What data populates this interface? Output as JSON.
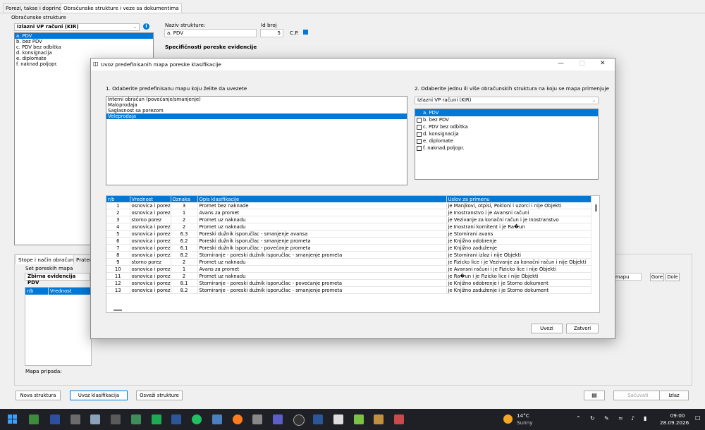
{
  "tabs": [
    {
      "label": "Porezi, takse i doprinosi"
    },
    {
      "label": "Obračunske strukture i veze sa dokumentima"
    }
  ],
  "left": {
    "title": "Obračunske strukture",
    "combo_value": "Izlazni VP računi (KIR)",
    "items": [
      {
        "label": "a. PDV"
      },
      {
        "label": "b. bez PDV"
      },
      {
        "label": "c. PDV bez odbitka"
      },
      {
        "label": "d. konsignacija"
      },
      {
        "label": "e. diplomate"
      },
      {
        "label": "f. naknad.poljopr."
      }
    ]
  },
  "form": {
    "naziv_label": "Naziv strukture:",
    "naziv_value": "a. PDV",
    "id_label": "Id broj",
    "id_value": "5",
    "cp_label": "C.P.",
    "section_title": "Specifičnosti poreske evidencije"
  },
  "lower": {
    "tab1": "Stope i način obračuna",
    "tab2": "Prateć",
    "set_label": "Set poreskih mapa",
    "set_combo": "Zbirna evidencija PDV",
    "col1": "r/b",
    "col2": "Vrednost",
    "mapu_label": "mapu",
    "gore": "Gore",
    "dole": "Dole",
    "mapa_pripada": "Mapa pripada:"
  },
  "dialog": {
    "title": "Uvoz predefinisanih mapa poreske klasifikacije",
    "step1": "1. Odaberite predefinisanu mapu koju želite da uvezete",
    "maps": [
      {
        "label": "Interni obračun (povećanje/smanjenje)"
      },
      {
        "label": "Maloprodaja"
      },
      {
        "label": "Saglasnost sa porezom"
      },
      {
        "label": "Veleprodaja"
      }
    ],
    "step2": "2. Odaberite jednu ili više obračunskih struktura na koju se mapa primenjuje",
    "struct_combo": "Izlazni VP računi (KIR)",
    "structures": [
      {
        "label": "a. PDV",
        "checked": true
      },
      {
        "label": "b. bez PDV",
        "checked": false
      },
      {
        "label": "c. PDV bez odbitka",
        "checked": false
      },
      {
        "label": "d. konsignacija",
        "checked": false
      },
      {
        "label": "e. diplomate",
        "checked": false
      },
      {
        "label": "f. naknad.poljopr.",
        "checked": false
      }
    ],
    "columns": [
      "r/b",
      "Vrednost",
      "Oznaka",
      "Opis klasifikacije",
      "Uslov za primenu"
    ],
    "rows": [
      [
        "1",
        "osnovica i porez",
        "3",
        "Promet bez naknade",
        "je Manjkovi, otpisi, Pokloni i uzorci i  nije Objekti"
      ],
      [
        "2",
        "osnovica i porez",
        "1",
        "Avans za promet",
        "je Inostranstvo i  je Avansni računi"
      ],
      [
        "3",
        "storno porez",
        "2",
        "Promet uz naknadu",
        "je Vezivanje za konačni račun i  je Inostranstvo"
      ],
      [
        "4",
        "osnovica i porez",
        "2",
        "Promet uz naknadu",
        "je Inostrani komitent i  je Ra�un"
      ],
      [
        "5",
        "osnovica i porez",
        "6.3",
        "Poreski dužnik isporučlac - smanjenje avansa",
        "je Stornirani avans"
      ],
      [
        "6",
        "osnovica i porez",
        "6.2",
        "Poreski dužnik isporučlac - smanjenje prometa",
        "je Knjižno odobrenje"
      ],
      [
        "7",
        "osnovica i porez",
        "6.1",
        "Poreski dužnik isporučlac - povećanje prometa",
        "je Knjižno zaduženje"
      ],
      [
        "8",
        "osnovica i porez",
        "8.2",
        "Storniranje - poreski dužnik isporučlac - smanjenje prometa",
        "je Stornirani izlaz i  nije Objekti"
      ],
      [
        "9",
        "storno porez",
        "2",
        "Promet uz naknadu",
        "je Fizicko lice i  je Vezivanje za konačni račun i  nije Objekti"
      ],
      [
        "10",
        "osnovica i porez",
        "1",
        "Avans za promet",
        "je Avansni računi i  je Fizicko lice i  nije Objekti"
      ],
      [
        "11",
        "osnovica i porez",
        "2",
        "Promet uz naknadu",
        "je Ra�un i  je Fizicko lice i  nije Objekti"
      ],
      [
        "12",
        "osnovica i porez",
        "8.1",
        "Storniranje - poreski dužnik isporučlac - povećanje prometa",
        "je Knjižno odobrenje i  je Storno dokument"
      ],
      [
        "13",
        "osnovica i porez",
        "8.2",
        "Storniranje - poreski dužnik isporučlac - smanjenje prometa",
        "je Knjižno zaduženje i  je Storno dokument"
      ]
    ],
    "uvezi": "Uvezi",
    "zatvori": "Zatvori"
  },
  "bottom": {
    "nova": "Nova struktura",
    "uvoz": "Uvoz klasifikacija",
    "osvezi": "Osveži strukture",
    "sacuvati": "Sačuvati",
    "izlaz": "Izlaz"
  },
  "taskbar": {
    "temp": "14°C",
    "weather": "Sunny",
    "time": "09:00",
    "date": "28.09.2026"
  },
  "colors": {
    "accent": "#0078d7",
    "taskbar": "#1f1f26"
  }
}
